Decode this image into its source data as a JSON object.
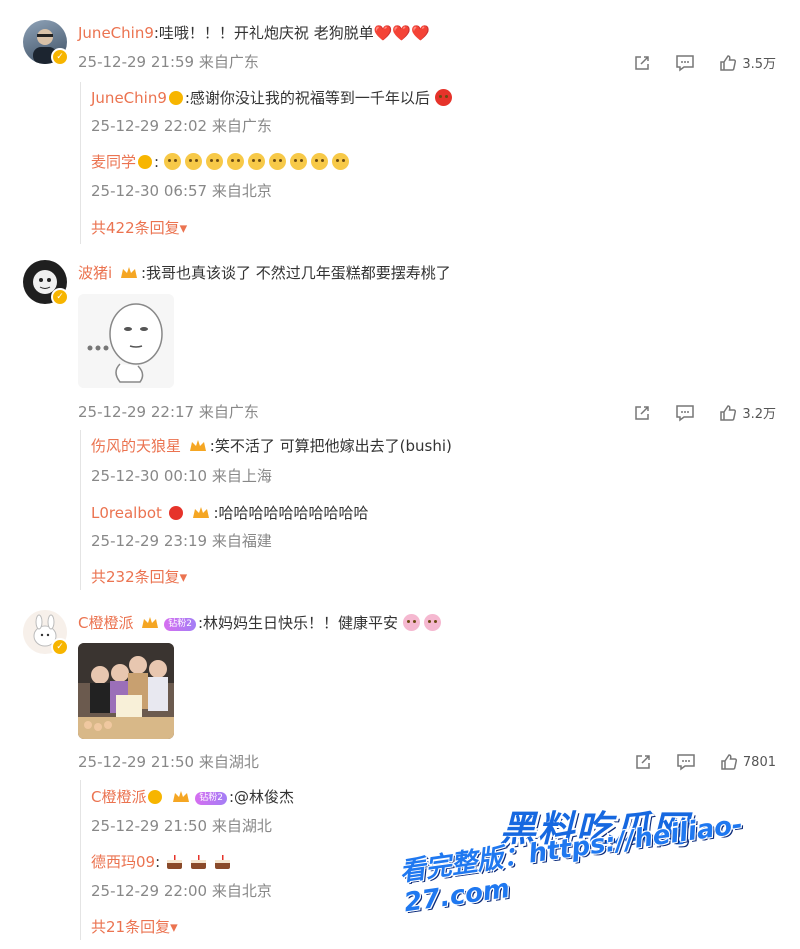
{
  "comments": [
    {
      "user": "JuneChin9",
      "text": ":哇哦！！！开礼炮庆祝 老狗脱单",
      "hearts": "❤️❤️❤️",
      "meta": "25-12-29 21:59 来自广东",
      "likes": "3.5万",
      "replies": [
        {
          "user": "JuneChin9",
          "text": ":感谢你没让我的祝福等到一千年以后",
          "meta": "25-12-29 22:02 来自广东"
        },
        {
          "user": "麦同学",
          "text": ":",
          "emoji_count": 9,
          "meta": "25-12-30 06:57 来自北京"
        }
      ],
      "more": "共422条回复"
    },
    {
      "user": "波猪i",
      "text": ":我哥也真该谈了 不然过几年蛋糕都要摆寿桃了",
      "image_desc": "meme",
      "meta": "25-12-29 22:17 来自广东",
      "likes": "3.2万",
      "replies": [
        {
          "user": "伤风的天狼星",
          "text": ":笑不活了 可算把他嫁出去了(bushi)",
          "meta": "25-12-30 00:10 来自上海"
        },
        {
          "user": "L0realbot",
          "text": ":哈哈哈哈哈哈哈哈哈哈",
          "meta": "25-12-29 23:19 来自福建"
        }
      ],
      "more": "共232条回复"
    },
    {
      "user": "C橙橙派",
      "fan_badge": "钻粉2",
      "text": ":林妈妈生日快乐！！健康平安",
      "meta": "25-12-29 21:50 来自湖北",
      "likes": "7801",
      "replies": [
        {
          "user": "C橙橙派",
          "fan_badge": "钻粉2",
          "text": ":@林俊杰",
          "meta": "25-12-29 21:50 来自湖北"
        },
        {
          "user": "德西玛09",
          "text": ":",
          "cake_count": 3,
          "meta": "25-12-29 22:00 来自北京"
        }
      ],
      "more": "共21条回复"
    }
  ],
  "watermark": {
    "title": "黑料吃瓜网",
    "subtitle": "看完整版：https://heiliao-27.com"
  },
  "colors": {
    "name": "#eb7350",
    "meta": "#888888",
    "badge": "#f7b500",
    "watermark": "#1668e0"
  },
  "icons": [
    "share-icon",
    "comment-icon",
    "like-icon",
    "verified-icon",
    "crown-icon",
    "chevron-down-icon"
  ]
}
